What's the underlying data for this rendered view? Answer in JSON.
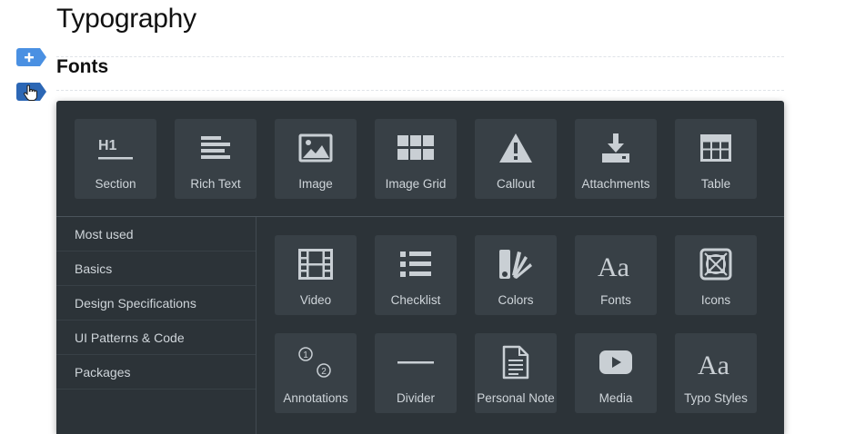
{
  "page": {
    "title": "Typography",
    "section_title": "Fonts"
  },
  "side_controls": {
    "add": {
      "icon": "plus-icon"
    },
    "drag": {
      "icon": "hand-cursor-icon"
    }
  },
  "colors": {
    "panel_bg": "#2c3338",
    "tile_bg": "#384046",
    "icon": "#c9cfd4",
    "add_tag": "#4a90e2",
    "drag_tag": "#2c67b5"
  },
  "blocks_top": [
    {
      "label": "Section",
      "icon": "heading-icon"
    },
    {
      "label": "Rich Text",
      "icon": "rich-text-icon"
    },
    {
      "label": "Image",
      "icon": "image-icon"
    },
    {
      "label": "Image Grid",
      "icon": "image-grid-icon"
    },
    {
      "label": "Callout",
      "icon": "warning-icon"
    },
    {
      "label": "Attachments",
      "icon": "download-icon"
    },
    {
      "label": "Table",
      "icon": "table-icon"
    }
  ],
  "categories": [
    {
      "label": "Most used"
    },
    {
      "label": "Basics"
    },
    {
      "label": "Design Specifications"
    },
    {
      "label": "UI Patterns & Code"
    },
    {
      "label": "Packages"
    }
  ],
  "blocks_grid": [
    {
      "label": "Video",
      "icon": "film-icon"
    },
    {
      "label": "Checklist",
      "icon": "checklist-icon"
    },
    {
      "label": "Colors",
      "icon": "color-swatches-icon"
    },
    {
      "label": "Fonts",
      "icon": "font-icon",
      "glyph": "Aa"
    },
    {
      "label": "Icons",
      "icon": "icon-frame-icon"
    },
    {
      "label": "Annotations",
      "icon": "annotations-icon",
      "marks": [
        "1",
        "2"
      ]
    },
    {
      "label": "Divider",
      "icon": "divider-icon"
    },
    {
      "label": "Personal Note",
      "icon": "note-icon"
    },
    {
      "label": "Media",
      "icon": "play-icon"
    },
    {
      "label": "Typo Styles",
      "icon": "typo-styles-icon",
      "glyph": "Aa"
    }
  ]
}
